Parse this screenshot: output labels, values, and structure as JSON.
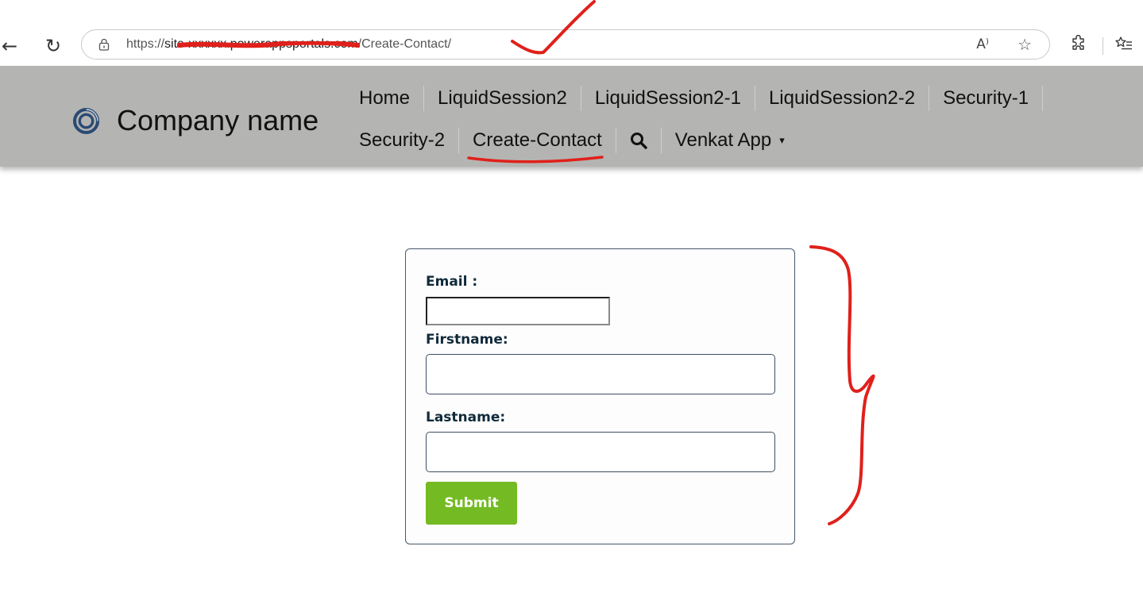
{
  "browser": {
    "url_scheme": "https://",
    "url_host": "site-xxxxxx.powerappsportals.com",
    "url_path": "/Create-Contact/",
    "back_icon": "back-arrow-icon",
    "refresh_icon": "refresh-icon",
    "lock_icon": "lock-icon",
    "read_aloud_icon": "read-aloud-icon",
    "read_aloud_glyph": "A⁾",
    "favorite_icon": "star-icon",
    "favorite_glyph": "☆",
    "extensions_icon": "extensions-icon",
    "favorites_bar_icon": "favorites-list-icon"
  },
  "header": {
    "brand_name": "Company name",
    "logo_icon": "company-logo-icon",
    "nav_items_row1": [
      "Home",
      "LiquidSession2",
      "LiquidSession2-1",
      "LiquidSession2-2",
      "Security-1"
    ],
    "nav_items_row2": [
      "Security-2",
      "Create-Contact"
    ],
    "search_icon": "search-icon",
    "dropdown_label": "Venkat App",
    "dropdown_caret": "▾"
  },
  "form": {
    "email_label": "Email :",
    "email_value": "",
    "firstname_label": "Firstname:",
    "firstname_value": "",
    "lastname_label": "Lastname:",
    "lastname_value": "",
    "submit_label": "Submit"
  },
  "colors": {
    "header_bg": "#b4b4b2",
    "submit_bg": "#74bb23",
    "label_color": "#102a3a",
    "annotation_red": "#e0201b"
  }
}
